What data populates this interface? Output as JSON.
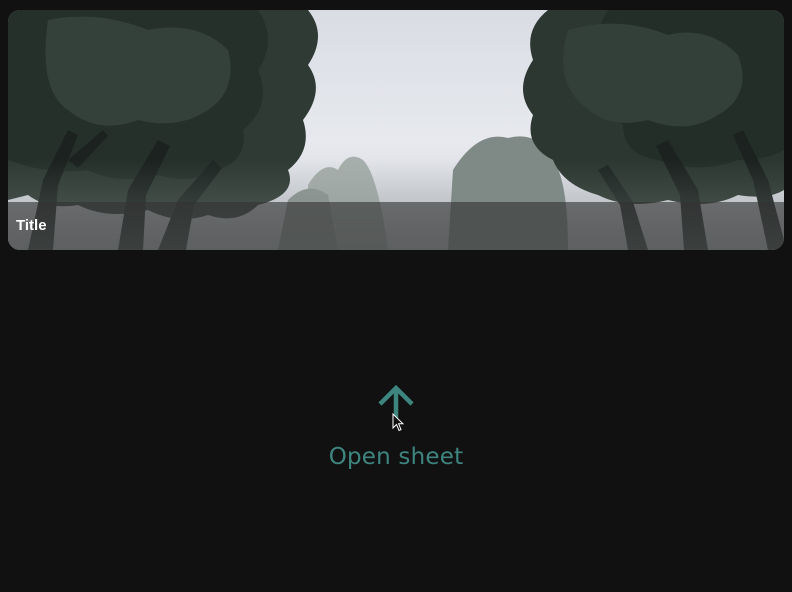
{
  "card": {
    "title": "Title",
    "image_subject": "misty-trees-photo"
  },
  "action": {
    "label": "Open sheet",
    "icon": "arrow-up-icon",
    "color": "#3e8580"
  },
  "theme": {
    "background": "#111111"
  }
}
